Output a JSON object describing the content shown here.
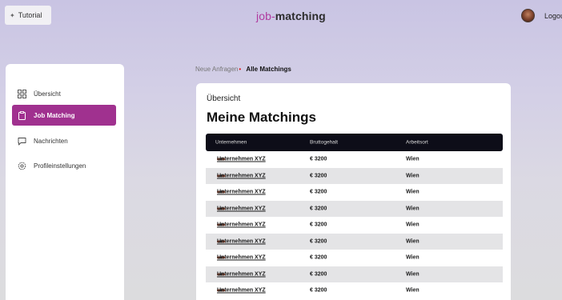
{
  "header": {
    "tutorial_label": "Tutorial",
    "tutorial_icon": "sparkle-icon",
    "logo_prefix": "job-",
    "logo_suffix": "matching",
    "logout_label": "Logou"
  },
  "sidebar": {
    "items": [
      {
        "label": "Übersicht",
        "icon": "grid-icon",
        "active": false
      },
      {
        "label": "Job Matching",
        "icon": "clipboard-icon",
        "active": true
      },
      {
        "label": "Nachrichten",
        "icon": "chat-bubble-icon",
        "active": false
      },
      {
        "label": "Profileinstellungen",
        "icon": "gear-icon",
        "active": false
      }
    ]
  },
  "breadcrumb": {
    "first": "Neue Anfragen",
    "current": "Alle Matchings"
  },
  "card": {
    "subtitle": "Übersicht",
    "title": "Meine Matchings"
  },
  "table": {
    "headers": [
      "Unternehmen",
      "Bruttogehalt",
      "Arbeitsort"
    ],
    "rows": [
      {
        "company": "Unternehmen XYZ",
        "salary": "€ 3200",
        "location": "Wien"
      },
      {
        "company": "Unternehmen XYZ",
        "salary": "€ 3200",
        "location": "Wien"
      },
      {
        "company": "Unternehmen XYZ",
        "salary": "€ 3200",
        "location": "Wien"
      },
      {
        "company": "Unternehmen XYZ",
        "salary": "€ 3200",
        "location": "Wien"
      },
      {
        "company": "Unternehmen XYZ",
        "salary": "€ 3200",
        "location": "Wien"
      },
      {
        "company": "Unternehmen XYZ",
        "salary": "€ 3200",
        "location": "Wien"
      },
      {
        "company": "Unternehmen XYZ",
        "salary": "€ 3200",
        "location": "Wien"
      },
      {
        "company": "Unternehmen XYZ",
        "salary": "€ 3200",
        "location": "Wien"
      },
      {
        "company": "Unternehmen XYZ",
        "salary": "€ 3200",
        "location": "Wien"
      }
    ]
  },
  "colors": {
    "accent": "#a0318f",
    "logo_accent": "#b03ba0",
    "table_header_bg": "#0d0d18",
    "row_stripe": "#e4e4e6"
  }
}
